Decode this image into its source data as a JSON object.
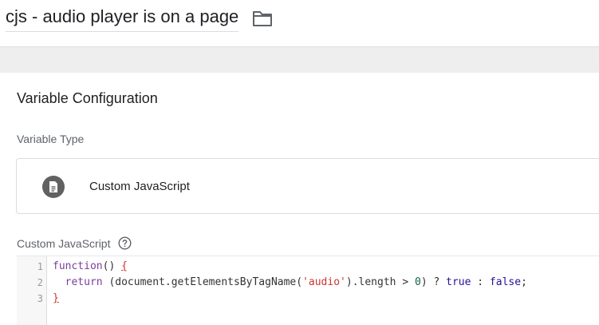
{
  "header": {
    "title": "cjs - audio player is on a page",
    "folder_icon": "folder-icon"
  },
  "card": {
    "title": "Variable Configuration",
    "variable_type_label": "Variable Type",
    "variable_type": {
      "name": "Custom JavaScript",
      "icon": "document-icon"
    },
    "code_label": "Custom JavaScript",
    "help_icon": "help-circle-icon"
  },
  "editor": {
    "line_numbers": [
      "1",
      "2",
      "3"
    ],
    "lines": [
      [
        {
          "t": "function",
          "c": "kw"
        },
        {
          "t": "() ",
          "c": "op"
        },
        {
          "t": "{",
          "c": "brace"
        }
      ],
      [
        {
          "t": "  ",
          "c": "op"
        },
        {
          "t": "return",
          "c": "kw"
        },
        {
          "t": " (document.getElementsByTagName(",
          "c": "op"
        },
        {
          "t": "'audio'",
          "c": "str"
        },
        {
          "t": ").length ",
          "c": "op"
        },
        {
          "t": ">",
          "c": "op"
        },
        {
          "t": " ",
          "c": "op"
        },
        {
          "t": "0",
          "c": "num"
        },
        {
          "t": ") ",
          "c": "op"
        },
        {
          "t": "?",
          "c": "op"
        },
        {
          "t": " ",
          "c": "op"
        },
        {
          "t": "true",
          "c": "bool"
        },
        {
          "t": " ",
          "c": "op"
        },
        {
          "t": ":",
          "c": "op"
        },
        {
          "t": " ",
          "c": "op"
        },
        {
          "t": "false",
          "c": "bool"
        },
        {
          "t": ";",
          "c": "op"
        }
      ],
      [
        {
          "t": "}",
          "c": "brace"
        }
      ]
    ]
  },
  "colors": {
    "keyword": "#7a3e9d",
    "string": "#cc3333",
    "number": "#116644",
    "atom": "#221199",
    "icon_bg": "#616161"
  }
}
